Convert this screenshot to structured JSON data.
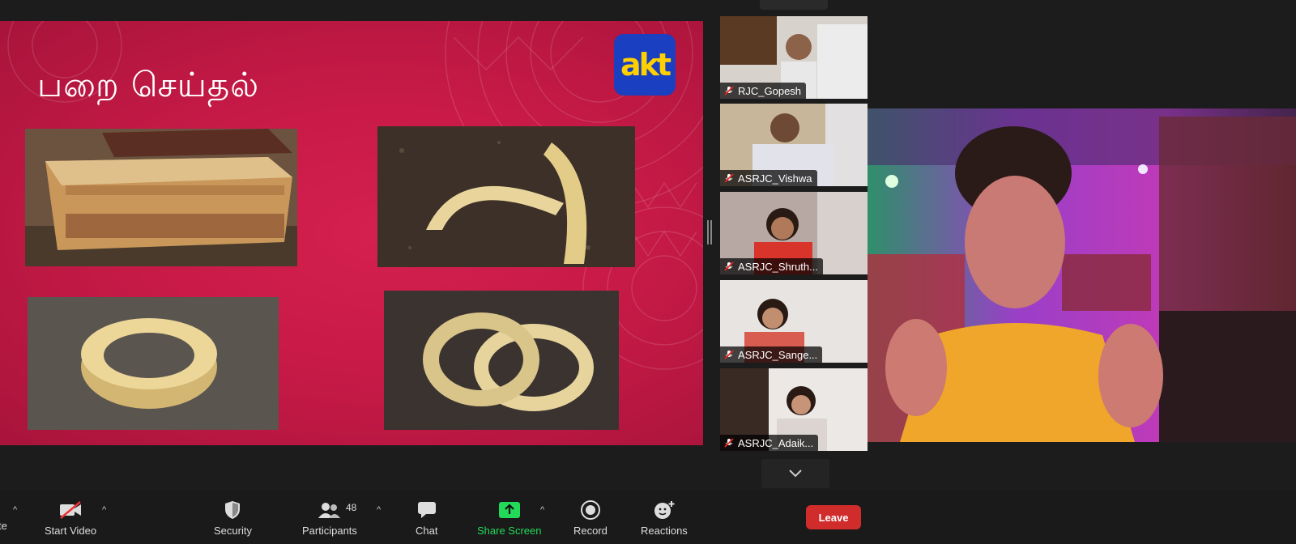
{
  "meeting": {
    "slide": {
      "title": "பறை செய்தல்",
      "logo_text": "akt",
      "photos": [
        "wooden-block-photo",
        "curved-wood-pieces-photo",
        "wooden-ring-photo",
        "two-wooden-rings-photo"
      ]
    },
    "participants_gallery": [
      {
        "name": "RJC_Gopesh",
        "muted": true
      },
      {
        "name": "ASRJC_Vishwa",
        "muted": true
      },
      {
        "name": "ASRJC_Shruth...",
        "muted": true
      },
      {
        "name": "ASRJC_Sange...",
        "muted": true
      },
      {
        "name": "ASRJC_Adaik...",
        "muted": true
      }
    ]
  },
  "toolbar": {
    "unmute_partial": "te",
    "start_video": "Start Video",
    "security": "Security",
    "participants": "Participants",
    "participants_count": "48",
    "chat": "Chat",
    "share_screen": "Share Screen",
    "record": "Record",
    "reactions": "Reactions",
    "leave": "Leave"
  },
  "colors": {
    "slide_bg": "#c81a47",
    "share_green": "#23d959",
    "leave_red": "#d12c2c",
    "logo_bg": "#1a3fc0",
    "logo_fg": "#ffd000"
  }
}
